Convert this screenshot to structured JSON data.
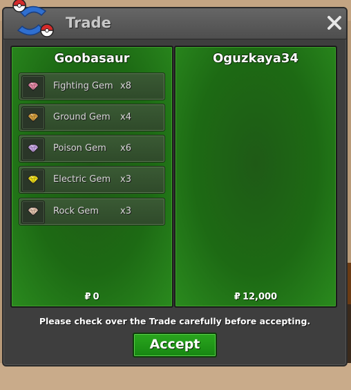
{
  "window": {
    "title": "Trade"
  },
  "left_panel": {
    "player": "Goobasaur",
    "money": "0",
    "items": [
      {
        "name": "Fighting Gem",
        "qty": "x8",
        "icon": "fighting-gem-icon",
        "color": "#e88aa8"
      },
      {
        "name": "Ground Gem",
        "qty": "x4",
        "icon": "ground-gem-icon",
        "color": "#d9a340"
      },
      {
        "name": "Poison Gem",
        "qty": "x6",
        "icon": "poison-gem-icon",
        "color": "#c9a6e6"
      },
      {
        "name": "Electric Gem",
        "qty": "x3",
        "icon": "electric-gem-icon",
        "color": "#f2e21a"
      },
      {
        "name": "Rock Gem",
        "qty": "x3",
        "icon": "rock-gem-icon",
        "color": "#e6c6b0"
      }
    ]
  },
  "right_panel": {
    "player": "Oguzkaya34",
    "money": "12,000"
  },
  "currency_symbol": "₽",
  "notice": "Please check over the Trade carefully before accepting.",
  "accept_label": "Accept"
}
